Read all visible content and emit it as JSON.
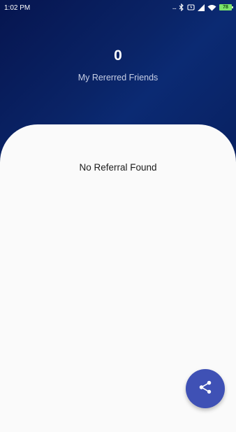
{
  "status_bar": {
    "time": "1:02 PM",
    "dots": "...",
    "battery": "78"
  },
  "referrals": {
    "count": "0",
    "label": "My Rererred Friends",
    "empty_message": "No Referral Found"
  },
  "fab": {
    "icon": "share-icon"
  },
  "colors": {
    "header_dark": "#06154f",
    "header_mid": "#0b2a73",
    "sheet_background": "#fafafa",
    "fab_background": "#3f51b5",
    "battery": "#7be36b"
  }
}
